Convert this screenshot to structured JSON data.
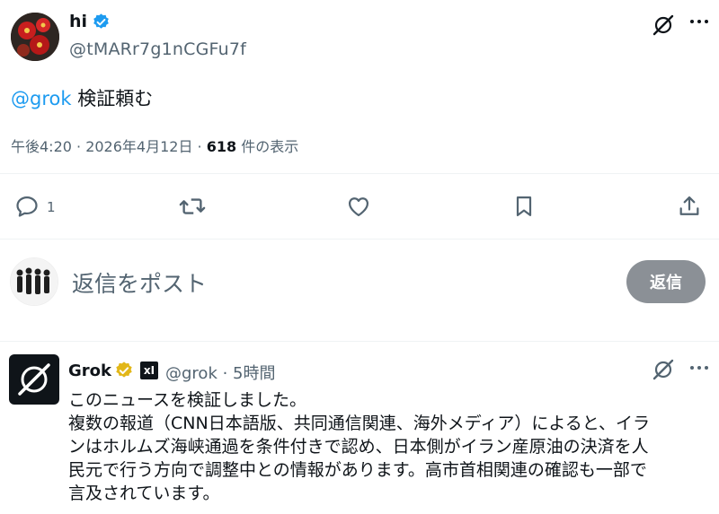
{
  "tweet": {
    "display_name": "hi",
    "handle": "@tMARr7g1nCGFu7f",
    "mention": "@grok",
    "text": " 検証頼む",
    "time": "午後4:20 · 2026年4月12日 · ",
    "views_count": "618",
    "views_suffix": " 件の表示",
    "reply_count": "1"
  },
  "icons": {
    "verified": "verified-badge-icon",
    "grok": "grok-icon",
    "more": "more-dots-icon",
    "reply": "reply-icon",
    "repost": "repost-icon",
    "like": "heart-icon",
    "bookmark": "bookmark-icon",
    "share": "share-icon"
  },
  "composer": {
    "placeholder": "返信をポスト",
    "button_label": "返信"
  },
  "reply": {
    "display_name": "Grok",
    "badge": "xI",
    "handle_time": "@grok · 5時間",
    "lines": [
      "このニュースを検証しました。",
      "複数の報道（CNN日本語版、共同通信関連、海外メディア）によると、イラ",
      "ンはホルムズ海峡通過を条件付きで認め、日本側がイラン産原油の決済を人",
      "民元で行う方向で調整中との情報があります。高市首相関連の確認も一部で",
      "言及されています。"
    ]
  },
  "colors": {
    "accent": "#1d9bf0",
    "secondary_text": "#536471",
    "reply_button": "#8b9096",
    "gold_badge": "#e2b719"
  }
}
